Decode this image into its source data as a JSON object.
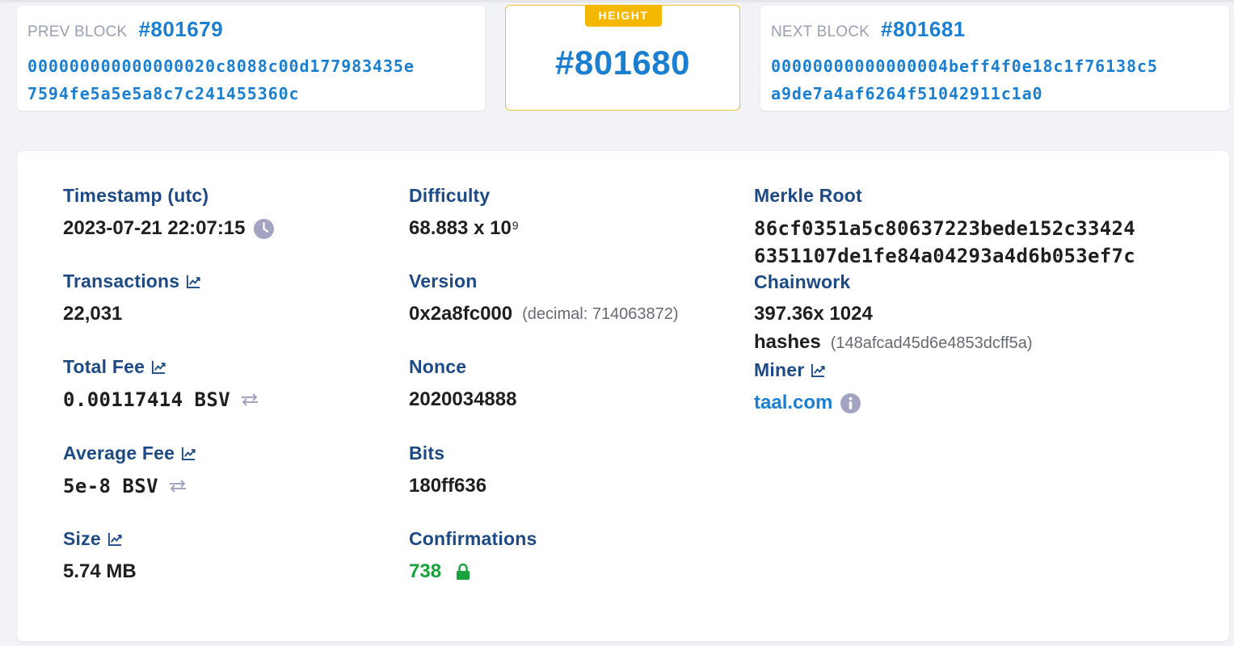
{
  "prev_block": {
    "tag": "PREV BLOCK",
    "number": "#801679",
    "hash_line1": "000000000000000020c8088c00d177983435e",
    "hash_line2": "7594fe5a5e5a8c7c241455360c"
  },
  "current_block": {
    "badge": "HEIGHT",
    "number": "#801680"
  },
  "next_block": {
    "tag": "NEXT BLOCK",
    "number": "#801681",
    "hash_line1": "00000000000000004beff4f0e18c1f76138c5",
    "hash_line2": "a9de7a4af6264f51042911c1a0"
  },
  "fields": {
    "timestamp": {
      "label": "Timestamp (utc)",
      "value": "2023-07-21 22:07:15",
      "icon": "clock-icon"
    },
    "transactions": {
      "label": "Transactions",
      "value": "22,031",
      "icon": "chart-icon"
    },
    "total_fee": {
      "label": "Total Fee",
      "value": "0.00117414",
      "unit": "BSV",
      "icon": "swap-icon"
    },
    "average_fee": {
      "label": "Average Fee",
      "value": "5e-8",
      "unit": "BSV",
      "icon": "swap-icon"
    },
    "size": {
      "label": "Size",
      "value": "5.74 MB",
      "icon": "chart-icon"
    },
    "difficulty": {
      "label": "Difficulty",
      "value": "68.883 x 10",
      "exponent": "9"
    },
    "version": {
      "label": "Version",
      "value": "0x2a8fc000",
      "decimal": "(decimal: 714063872)"
    },
    "nonce": {
      "label": "Nonce",
      "value": "2020034888"
    },
    "bits": {
      "label": "Bits",
      "value": "180ff636"
    },
    "confirmations": {
      "label": "Confirmations",
      "value": "738",
      "icon": "lock-icon"
    },
    "merkle_root": {
      "label": "Merkle Root",
      "line1": "86cf0351a5c80637223bede152c33424",
      "line2": "6351107de1fe84a04293a4d6b053ef7c"
    },
    "chainwork": {
      "label": "Chainwork",
      "value_line1": "397.36x 1024",
      "value_line2": "hashes",
      "hex": "(148afcad45d6e4853dcff5a)"
    },
    "miner": {
      "label": "Miner",
      "value": "taal.com",
      "icon": "info-icon"
    }
  },
  "colors": {
    "accent": "#1a7fd1",
    "label": "#1d4a85",
    "badge": "#f5b800",
    "confirmations": "#18a33c",
    "icon_muted": "#9aa0c4"
  }
}
